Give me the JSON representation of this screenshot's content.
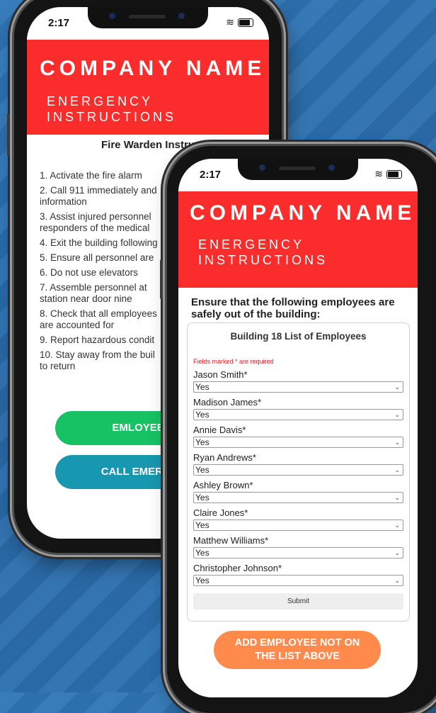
{
  "back_phone": {
    "status": {
      "time": "2:17"
    },
    "header": {
      "brand": "COMPANY NAME",
      "subtitle_line1": "ENERGENCY",
      "subtitle_line2": "INSTRUCTIONS"
    },
    "section_title": "Fire Warden Instru",
    "steps": [
      "1. Activate the fire alarm",
      "2. Call 911 immediately and",
      "information",
      "3. Assist injured personnel",
      "responders of the medical",
      "4. Exit the building following",
      "5. Ensure all personnel are",
      "6. Do not use elevators",
      "7. Assemble personnel at",
      "station near door nine",
      "8. Check that all employees",
      "are accounted for",
      "9. Report hazardous condit",
      "10. Stay away from the buil",
      "to return"
    ],
    "buttons": {
      "employee_check": "EMLOYEE CH",
      "call_emergency": "CALL EMERGENC"
    }
  },
  "front_phone": {
    "status": {
      "time": "2:17"
    },
    "header": {
      "brand": "COMPANY NAME",
      "subtitle_line1": "ENERGENCY",
      "subtitle_line2": "INSTRUCTIONS"
    },
    "heading": "Ensure that the following employees are safely out of the building:",
    "form": {
      "title": "Building 18 List of Employees",
      "required_note": "Fields marked * are required",
      "employees": [
        {
          "name": "Jason Smith*",
          "value": "Yes"
        },
        {
          "name": "Madison James*",
          "value": "Yes"
        },
        {
          "name": "Annie Davis*",
          "value": "Yes"
        },
        {
          "name": "Ryan Andrews*",
          "value": "Yes"
        },
        {
          "name": "Ashley Brown*",
          "value": "Yes"
        },
        {
          "name": "Claire Jones*",
          "value": "Yes"
        },
        {
          "name": "Matthew Williams*",
          "value": "Yes"
        },
        {
          "name": "Christopher Johnson*",
          "value": "Yes"
        }
      ],
      "submit_label": "Submit"
    },
    "add_button": "ADD EMPLOYEE NOT ON THE LIST ABOVE"
  },
  "colors": {
    "header_red": "#fb2c2c",
    "green_button": "#16c264",
    "teal_button": "#1797b0",
    "orange_button": "#ff8a4c",
    "background_blue": "#2c6fae"
  },
  "icons": [
    "wifi-icon",
    "battery-icon",
    "chevron-down-icon"
  ]
}
